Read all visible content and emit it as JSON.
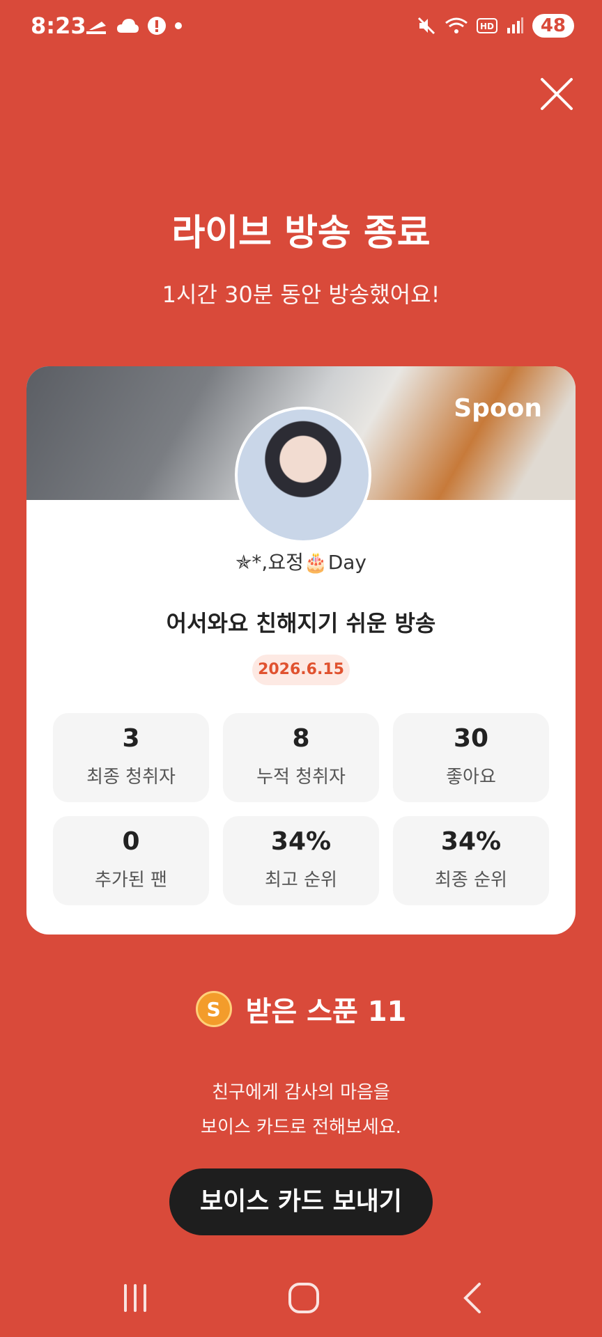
{
  "status_bar": {
    "time": "8:23",
    "battery": "48"
  },
  "header": {
    "title": "라이브 방송 종료",
    "subtitle": "1시간 30분 동안 방송했어요!"
  },
  "card": {
    "brand": "Spoon",
    "nickname": "✯*,요정🎂Day",
    "broadcast_title": "어서와요 친해지기 쉬운 방송",
    "date": "2026.6.15",
    "stats": [
      {
        "value": "3",
        "label": "최종 청취자"
      },
      {
        "value": "8",
        "label": "누적 청취자"
      },
      {
        "value": "30",
        "label": "좋아요"
      },
      {
        "value": "0",
        "label": "추가된 팬"
      },
      {
        "value": "34%",
        "label": "최고 순위"
      },
      {
        "value": "34%",
        "label": "최종 순위"
      }
    ]
  },
  "spoons": {
    "label": "받은 스푼  11",
    "coin": "S"
  },
  "message": {
    "line1": "친구에게 감사의 마음을",
    "line2": "보이스 카드로 전해보세요."
  },
  "button": {
    "label": "보이스 카드 보내기"
  }
}
